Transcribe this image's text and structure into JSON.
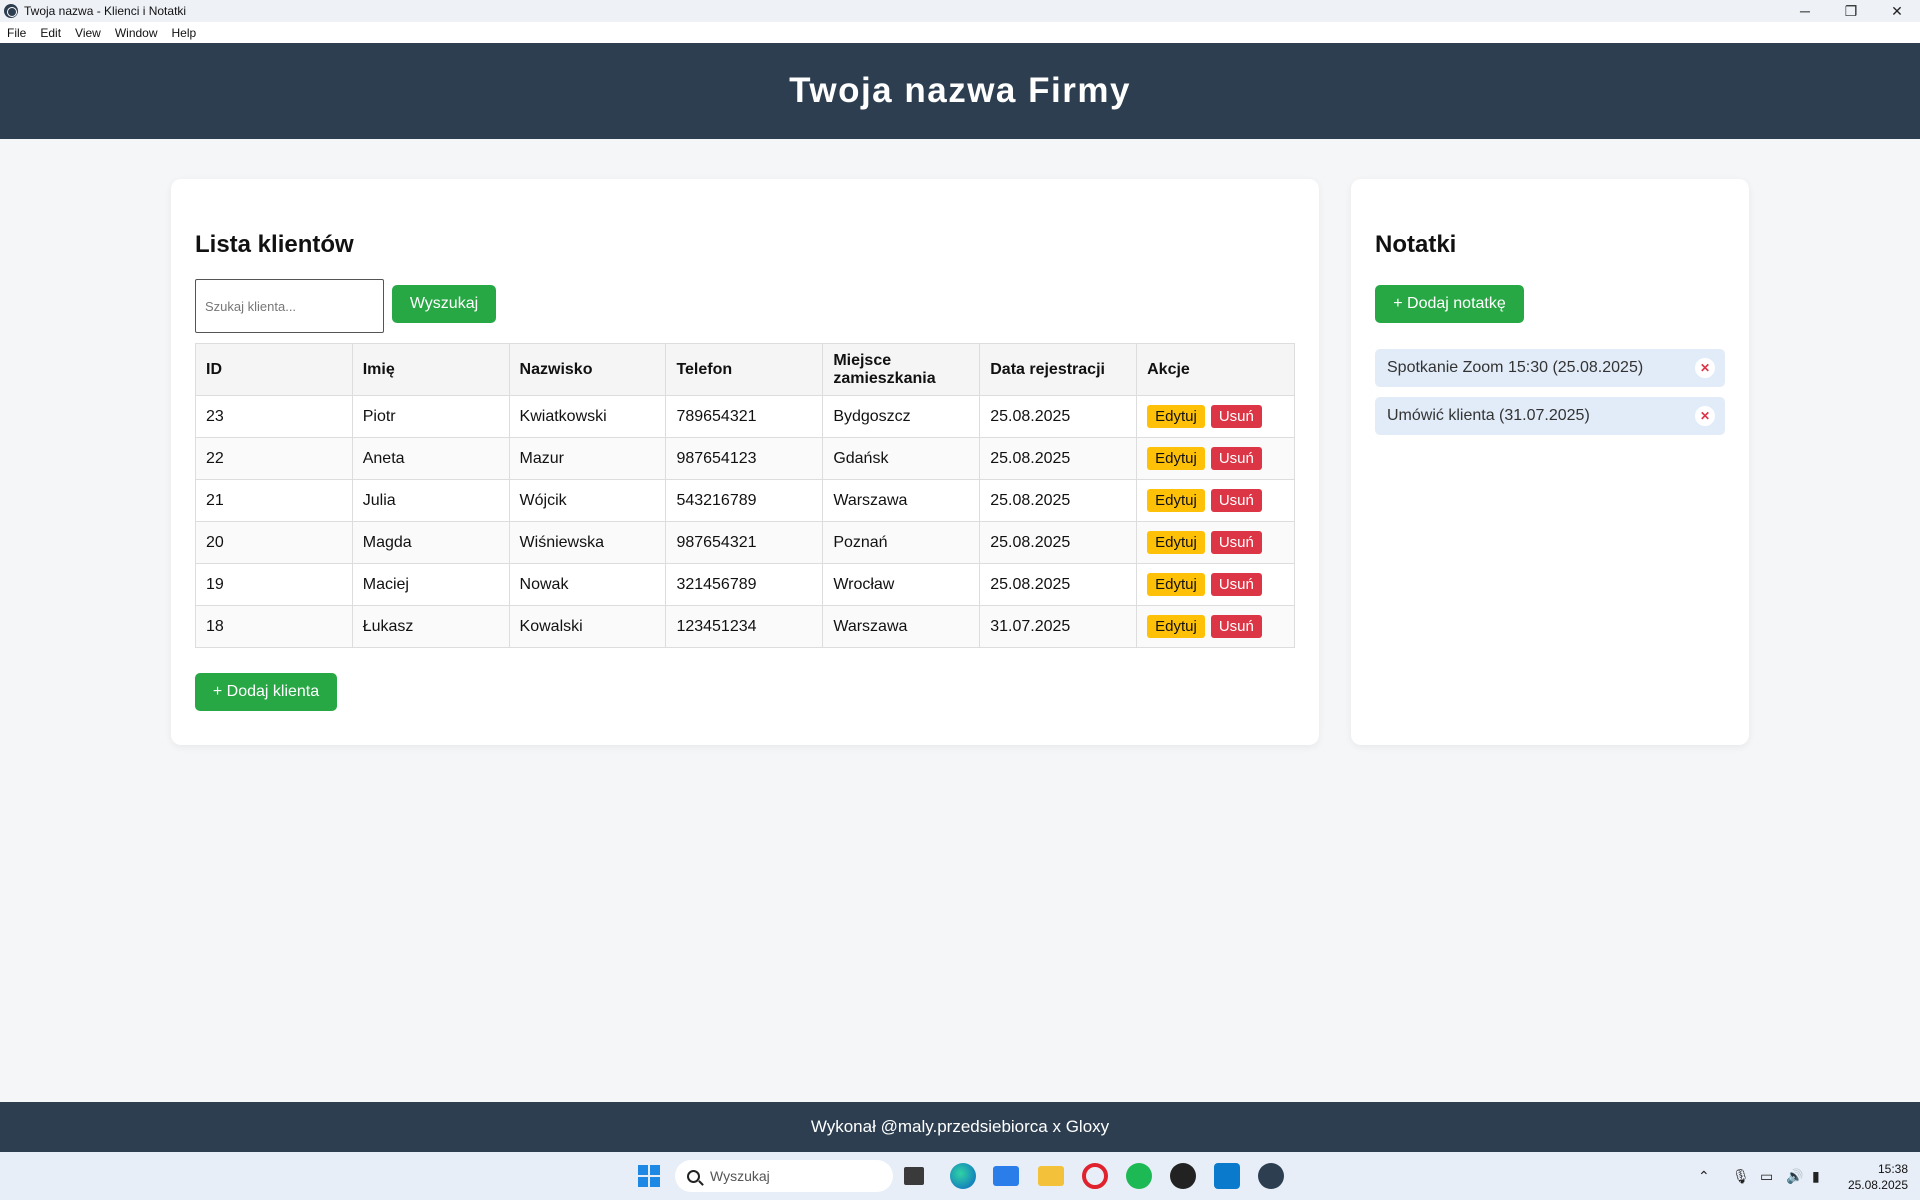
{
  "window": {
    "title": "Twoja nazwa - Klienci i Notatki",
    "controls": {
      "minimize": "─",
      "restore": "❐",
      "close": "✕"
    }
  },
  "menu": [
    "File",
    "Edit",
    "View",
    "Window",
    "Help"
  ],
  "header": {
    "title": "Twoja nazwa Firmy"
  },
  "clients": {
    "title": "Lista klientów",
    "search_placeholder": "Szukaj klienta...",
    "search_value": "",
    "search_button": "Wyszukaj",
    "columns": [
      "ID",
      "Imię",
      "Nazwisko",
      "Telefon",
      "Miejsce zamieszkania",
      "Data rejestracji",
      "Akcje"
    ],
    "rows": [
      {
        "id": "23",
        "first": "Piotr",
        "last": "Kwiatkowski",
        "phone": "789654321",
        "city": "Bydgoszcz",
        "date": "25.08.2025"
      },
      {
        "id": "22",
        "first": "Aneta",
        "last": "Mazur",
        "phone": "987654123",
        "city": "Gdańsk",
        "date": "25.08.2025"
      },
      {
        "id": "21",
        "first": "Julia",
        "last": "Wójcik",
        "phone": "543216789",
        "city": "Warszawa",
        "date": "25.08.2025"
      },
      {
        "id": "20",
        "first": "Magda",
        "last": "Wiśniewska",
        "phone": "987654321",
        "city": "Poznań",
        "date": "25.08.2025"
      },
      {
        "id": "19",
        "first": "Maciej",
        "last": "Nowak",
        "phone": "321456789",
        "city": "Wrocław",
        "date": "25.08.2025"
      },
      {
        "id": "18",
        "first": "Łukasz",
        "last": "Kowalski",
        "phone": "123451234",
        "city": "Warszawa",
        "date": "31.07.2025"
      }
    ],
    "edit_label": "Edytuj",
    "delete_label": "Usuń",
    "add_button": "+ Dodaj klienta"
  },
  "notes": {
    "title": "Notatki",
    "add_button": "+ Dodaj notatkę",
    "items": [
      {
        "text": "Spotkanie Zoom 15:30 (25.08.2025)",
        "delete": "✕"
      },
      {
        "text": "Umówić klienta (31.07.2025)",
        "delete": "✕"
      }
    ]
  },
  "footer": {
    "text": "Wykonał @maly.przedsiebiorca x Gloxy"
  },
  "taskbar": {
    "search_placeholder": "Wyszukaj",
    "apps": [
      "file-explorer-icon",
      "edge-icon",
      "photos-icon",
      "folder-icon",
      "opera-icon",
      "spotify-icon",
      "obs-icon",
      "vscode-icon",
      "electron-app-icon"
    ],
    "clock_time": "15:38",
    "clock_date": "25.08.2025"
  },
  "colors": {
    "header": "#2c3e50",
    "primary_button": "#28a745",
    "edit_button": "#ffc107",
    "delete_button": "#dc3545",
    "note_background": "#e2ecf9"
  }
}
